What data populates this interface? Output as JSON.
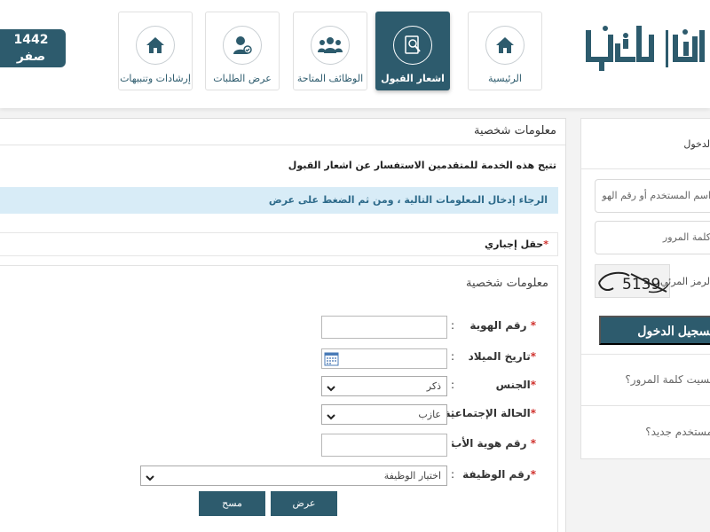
{
  "header": {
    "date_year": "1442",
    "date_month": "صفر",
    "nav": [
      {
        "label": "الرئيسية",
        "icon": "home-icon"
      },
      {
        "label": "اشعار القبول",
        "icon": "acceptance-notice-icon",
        "active": true
      },
      {
        "label": "الوظائف المتاحة",
        "icon": "group-users-icon"
      },
      {
        "label": "عرض الطلبات",
        "icon": "user-check-icon"
      },
      {
        "label": "إرشادات وتنبيهات",
        "icon": "home-icon"
      }
    ],
    "logo_text": "جدارة | وظايف"
  },
  "main": {
    "title": "معلومات شخصية",
    "service_description": "تتيح هذه الخدمة للمتقدمين الاستفسار عن اشعار القبول",
    "info_message": "الرجاء إدخال المعلومات التالية ، ومن ثم الضغط على عرض",
    "required_note": "حقل إجباري",
    "form_title": "معلومات شخصية",
    "fields": {
      "national_id": {
        "label": "رقم الهوية",
        "value": ""
      },
      "birth_date": {
        "label": "تاريخ الميلاد",
        "value": ""
      },
      "gender": {
        "label": "الجنس",
        "value": "ذكر"
      },
      "marital_status": {
        "label": "الحالة الإجتماعية",
        "value": "عازب"
      },
      "father_id": {
        "label": "رقم هوية الأب",
        "value": ""
      },
      "job_number": {
        "label": "رقم الوظيفة",
        "value": "اختيار الوظيفة"
      }
    },
    "colon": ":",
    "star": "*",
    "buttons": {
      "show": "عرض",
      "clear": "مسح"
    }
  },
  "login": {
    "title": "الدخول",
    "username_placeholder": "اسم المستخدم أو رقم الهو",
    "password_placeholder": "كلمة المرور",
    "captcha_label": "الرمز المرئي",
    "captcha_text": "5139",
    "login_button": "تسجيل الدخول",
    "forgot_password": "نسيت كلمة المرور؟",
    "new_user": "مستخدم جديد؟"
  },
  "colors": {
    "primary": "#2d5b6d",
    "info_bg": "#d8ecf7",
    "required": "#d0312d"
  }
}
